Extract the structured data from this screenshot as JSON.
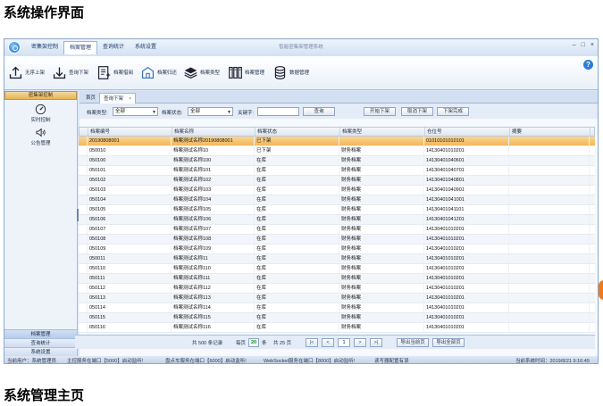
{
  "headings": {
    "top": "系统操作界面",
    "bottom": "系统管理主页"
  },
  "app": {
    "title": "智能密集架管理系统"
  },
  "menu": [
    "密集架控制",
    "档案管理",
    "查询统计",
    "系统设置"
  ],
  "window_controls": [
    "–",
    "□",
    "×"
  ],
  "help": "?",
  "ribbon": [
    {
      "label": "无序上架",
      "icon": "upload-icon"
    },
    {
      "label": "查询下架",
      "icon": "download-icon"
    },
    {
      "label": "档案借阅",
      "icon": "document-icon"
    },
    {
      "label": "档案归还",
      "icon": "return-icon"
    },
    {
      "label": "档案类型",
      "icon": "layers-icon"
    },
    {
      "label": "档案管理",
      "icon": "books-icon"
    },
    {
      "label": "数据管理",
      "icon": "database-icon"
    }
  ],
  "sidebar": {
    "header": "密集架控制",
    "items": [
      {
        "label": "实时控制",
        "icon": "speedometer-icon"
      },
      {
        "label": "公告管理",
        "icon": "speaker-icon"
      }
    ],
    "bottom": [
      "档案管理",
      "查询统计",
      "系统设置"
    ]
  },
  "tabs": [
    {
      "label": "首页"
    },
    {
      "label": "查询下架",
      "close": "×"
    }
  ],
  "filters": {
    "type_label": "档案类型:",
    "type_value": "全部",
    "status_label": "档案状态:",
    "status_value": "全部",
    "keyword_label": "关键字:",
    "keyword_value": "",
    "search_button": "查询",
    "start_button": "开始下架",
    "cancel_button": "取消下架",
    "finish_button": "下架完成"
  },
  "grid": {
    "columns": [
      "档案编号",
      "档案名称",
      "档案状态",
      "档案类型",
      "仓位号",
      "摘要"
    ],
    "rows": [
      [
        "20190808001",
        "档案测试名称20190808001",
        "已下架",
        "",
        "01010101010101",
        ""
      ],
      [
        "050010",
        "档案测试名称10",
        "已下架",
        "财务档案",
        "14130401010201",
        ""
      ],
      [
        "050100",
        "档案测试名称100",
        "在库",
        "财务档案",
        "14130401040601",
        ""
      ],
      [
        "050101",
        "档案测试名称101",
        "在库",
        "财务档案",
        "14130401040701",
        ""
      ],
      [
        "050102",
        "档案测试名称102",
        "在库",
        "财务档案",
        "14130401040801",
        ""
      ],
      [
        "050103",
        "档案测试名称103",
        "在库",
        "财务档案",
        "14130401040901",
        ""
      ],
      [
        "050104",
        "档案测试名称104",
        "在库",
        "财务档案",
        "14130401041001",
        ""
      ],
      [
        "050105",
        "档案测试名称105",
        "在库",
        "财务档案",
        "14130401041101",
        ""
      ],
      [
        "050106",
        "档案测试名称106",
        "在库",
        "财务档案",
        "14130401041201",
        ""
      ],
      [
        "050107",
        "档案测试名称107",
        "在库",
        "财务档案",
        "14130401010201",
        ""
      ],
      [
        "050108",
        "档案测试名称108",
        "在库",
        "财务档案",
        "14130401010201",
        ""
      ],
      [
        "050109",
        "档案测试名称109",
        "在库",
        "财务档案",
        "14130401010201",
        ""
      ],
      [
        "050011",
        "档案测试名称11",
        "在库",
        "财务档案",
        "14130401010201",
        ""
      ],
      [
        "050110",
        "档案测试名称110",
        "在库",
        "财务档案",
        "14130401010201",
        ""
      ],
      [
        "050111",
        "档案测试名称111",
        "在库",
        "财务档案",
        "14130401010201",
        ""
      ],
      [
        "050112",
        "档案测试名称112",
        "在库",
        "财务档案",
        "14130401010201",
        ""
      ],
      [
        "050113",
        "档案测试名称113",
        "在库",
        "财务档案",
        "14130401010201",
        ""
      ],
      [
        "050114",
        "档案测试名称114",
        "在库",
        "财务档案",
        "14130401010201",
        ""
      ],
      [
        "050115",
        "档案测试名称115",
        "在库",
        "财务档案",
        "14130401010201",
        ""
      ],
      [
        "050116",
        "档案测试名称116",
        "在库",
        "财务档案",
        "14130401010201",
        ""
      ]
    ]
  },
  "pager": {
    "total": "共 500 条记录",
    "per_page_label": "每页",
    "per_page": "20",
    "per_page_unit": "条",
    "pages": "共 25 页",
    "first": "|<",
    "prev": "<",
    "current": "1",
    "next": ">",
    "last": ">|",
    "export_current": "导出当前页",
    "export_all": "导出全部页"
  },
  "status": {
    "user": "当前用户：系统管理员",
    "service1": "主控服务在端口【5000】启动监听!",
    "service2": "盘点车服务在端口【6000】启动监听!",
    "service3": "WebSocket服务在端口【8000】启动监听!",
    "reader": "读写器配置有误",
    "time": "当前系统时间：2019/8/21 9:16:49"
  },
  "colors": {
    "accent": "#1e6fc9",
    "selected_row": "#f3b75a",
    "knob": "#ef7a1a"
  }
}
